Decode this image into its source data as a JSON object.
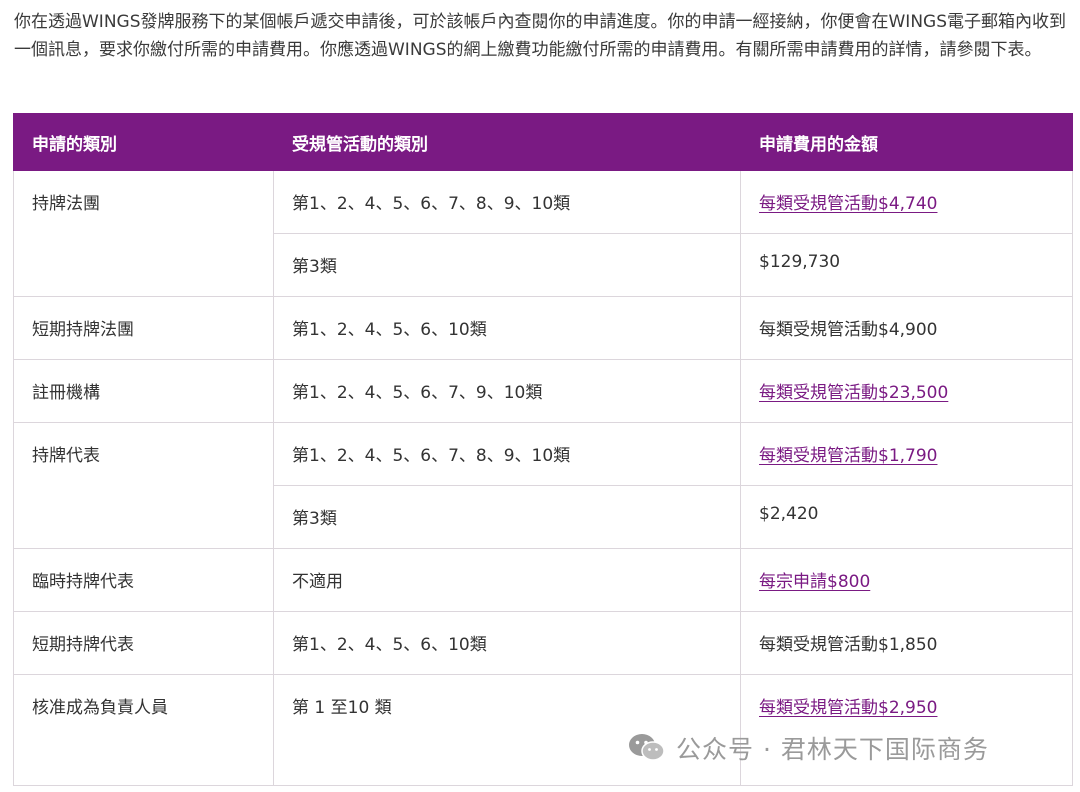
{
  "intro": "你在透過WINGS發牌服務下的某個帳戶遞交申請後，可於該帳戶內查閱你的申請進度。你的申請一經接納，你便會在WINGS電子郵箱內收到一個訊息，要求你繳付所需的申請費用。你應透過WINGS的網上繳費功能繳付所需的申請費用。有關所需申請費用的詳情，請參閱下表。",
  "table": {
    "headers": [
      "申請的類別",
      "受規管活動的類別",
      "申請費用的金額"
    ],
    "groups": [
      {
        "category": "持牌法團",
        "rows": [
          {
            "activities": "第1、2、4、5、6、7、8、9、10類",
            "fee": "每類受規管活動$4,740",
            "link": true
          },
          {
            "activities": "第3類",
            "fee": "$129,730",
            "link": false
          }
        ]
      },
      {
        "category": "短期持牌法團",
        "rows": [
          {
            "activities": "第1、2、4、5、6、10類",
            "fee": "每類受規管活動$4,900",
            "link": false
          }
        ]
      },
      {
        "category": "註冊機構",
        "rows": [
          {
            "activities": "第1、2、4、5、6、7、9、10類",
            "fee": "每類受規管活動$23,500",
            "link": true
          }
        ]
      },
      {
        "category": "持牌代表",
        "rows": [
          {
            "activities": "第1、2、4、5、6、7、8、9、10類",
            "fee": "每類受規管活動$1,790",
            "link": true
          },
          {
            "activities": "第3類",
            "fee": "$2,420",
            "link": false
          }
        ]
      },
      {
        "category": "臨時持牌代表",
        "rows": [
          {
            "activities": "不適用",
            "fee": "每宗申請$800",
            "link": true
          }
        ]
      },
      {
        "category": "短期持牌代表",
        "rows": [
          {
            "activities": "第1、2、4、5、6、10類",
            "fee": "每類受規管活動$1,850",
            "link": false
          }
        ]
      },
      {
        "category": "核准成為負責人員",
        "rows": [
          {
            "activities": "第 1 至10 類",
            "fee": "每類受規管活動$2,950",
            "link": true
          }
        ]
      }
    ]
  },
  "watermark": {
    "text": "公众号 · 君林天下国际商务",
    "icon": "wechat-icon"
  },
  "colors": {
    "header_bg": "#7a1a83",
    "link": "#7a1a83",
    "border": "#dcd6dc"
  }
}
